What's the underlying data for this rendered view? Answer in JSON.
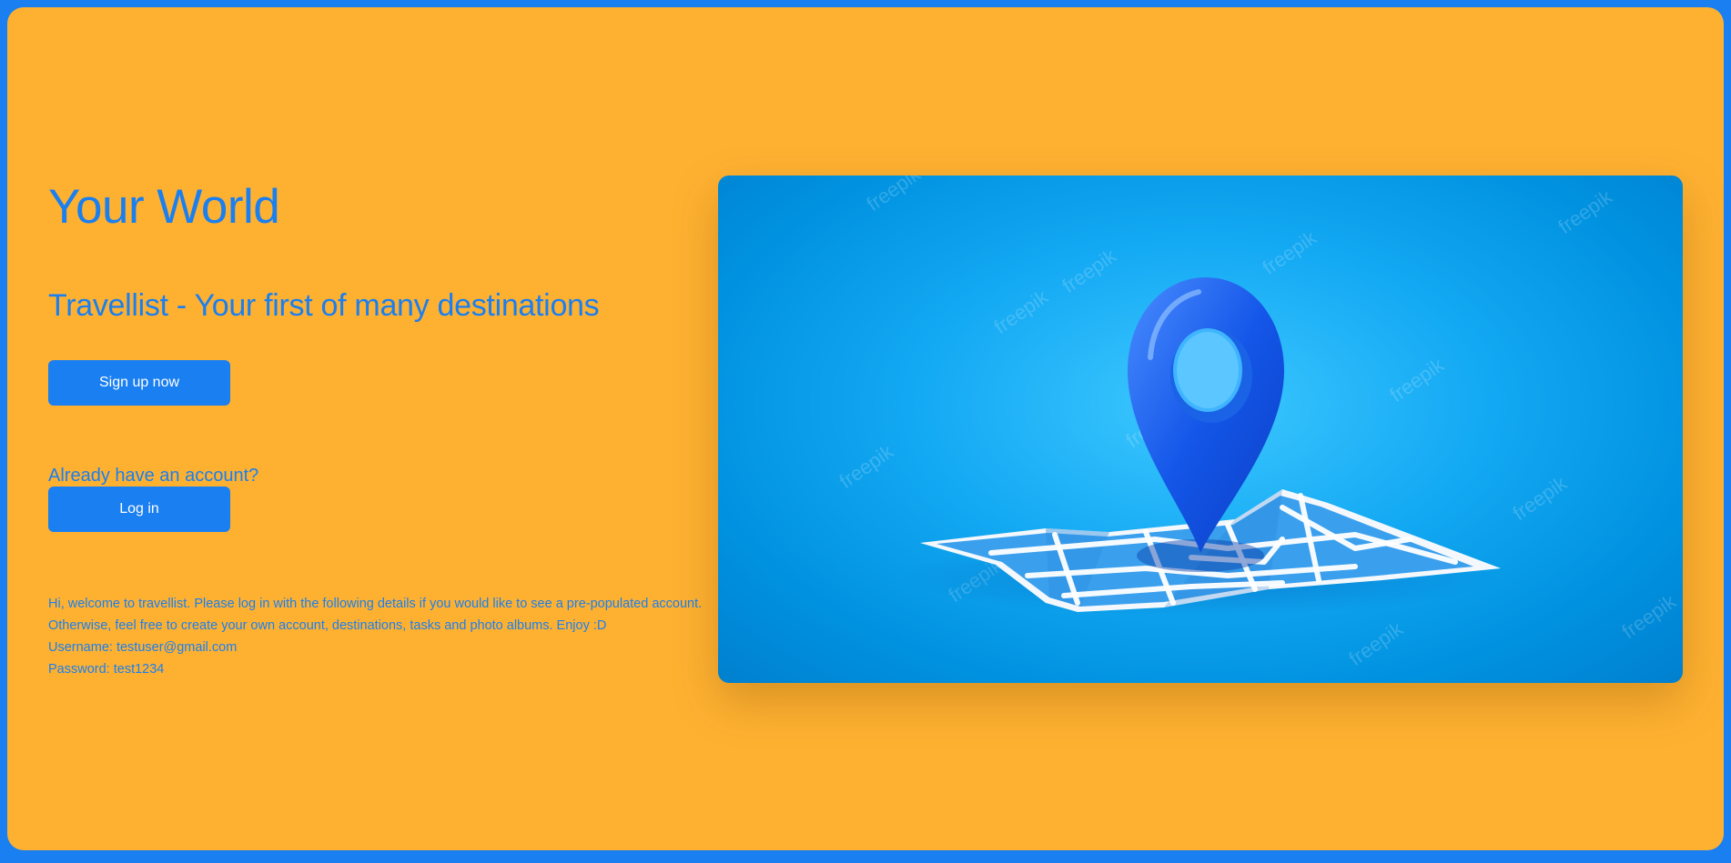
{
  "hero": {
    "title": "Your World",
    "subtitle": "Travellist - Your first of many destinations"
  },
  "actions": {
    "signup_label": "Sign up now",
    "already_text": "Already have an account?",
    "login_label": "Log in"
  },
  "info": {
    "welcome_line": "Hi, welcome to travellist. Please log in with the following details if you would like to see a pre-populated account. Otherwise, feel free to create your own account, destinations, tasks and photo albums. Enjoy :D",
    "username_line": "Username: testuser@gmail.com",
    "password_line": "Password: test1234"
  },
  "image": {
    "subject": "location-pin-on-map-illustration",
    "watermark": "freepik"
  },
  "colors": {
    "page_border": "#1a7ff0",
    "background": "#feb131",
    "accent": "#1a7ff0",
    "button_text": "#ffffff"
  }
}
